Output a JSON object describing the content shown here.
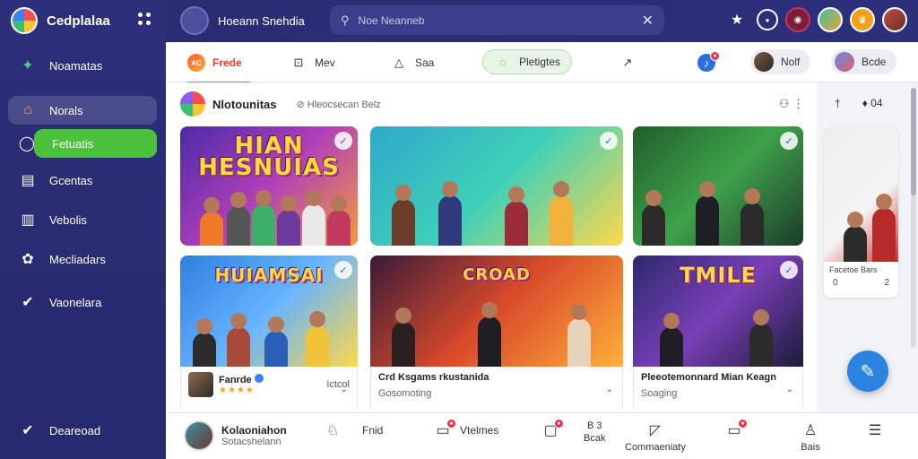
{
  "app": {
    "name": "Cedplalaa"
  },
  "sidebar": {
    "items": [
      {
        "label": "Noamatas",
        "icon": "sparkle-icon"
      },
      {
        "label": "Norals",
        "icon": "home-icon"
      },
      {
        "label": "Fetuatis",
        "icon": "circle-icon"
      },
      {
        "label": "Gcentas",
        "icon": "file-icon"
      },
      {
        "label": "Vebolis",
        "icon": "chart-icon"
      },
      {
        "label": "Mecliadars",
        "icon": "puzzle-icon"
      },
      {
        "label": "Vaonelara",
        "icon": "check-circle-icon"
      }
    ],
    "footer": {
      "label": "Deareoad",
      "icon": "check-icon"
    }
  },
  "header": {
    "profile_label": "Hoeann Snehdia",
    "search": {
      "placeholder": "Noe Neanneb"
    }
  },
  "tabs": [
    {
      "label": "Frede",
      "logo_text": "AC"
    },
    {
      "label": "Mev"
    },
    {
      "label": "Saa"
    },
    {
      "label": "Pletigtes"
    },
    {
      "label": ""
    },
    {
      "label": "Nolf"
    },
    {
      "label": "Bcde"
    }
  ],
  "section": {
    "title": "Nlotounitas",
    "subtitle": "Hleocsecan  Belz"
  },
  "cards": [
    {
      "thumb_text": "HIAN\nHESNUIAS",
      "title": "",
      "subtitle": "",
      "bg": "#6b3fb8"
    },
    {
      "thumb_text": "",
      "title": "",
      "subtitle": "",
      "bg": "#3fb6c8"
    },
    {
      "thumb_text": "",
      "title": "",
      "subtitle": "",
      "bg": "#2e7d3a"
    },
    {
      "thumb_text": "HUIAMSAI",
      "title": "Fanrde",
      "subtitle": "Ictcol",
      "stars": "★★★★",
      "bg": "#3a8fe0"
    },
    {
      "thumb_text": "CROAD",
      "title": "Crd Ksgams rkustanida",
      "subtitle": "Gosomoting",
      "bg": "#8a1e3e"
    },
    {
      "thumb_text": "TMILE",
      "title": "Pleeotemonnard  Mian Keagn",
      "subtitle": "Soaging",
      "bg": "#3a2c6b"
    }
  ],
  "right_panel": {
    "header_a": "†",
    "header_b": "♦ 04",
    "meta": "Facetoe Bars",
    "meta_left": "0",
    "meta_right": "2"
  },
  "bottom": {
    "user_name": "Kolaoniahon",
    "user_sub": "Sotacshelann",
    "items": [
      {
        "label": "Fnid"
      },
      {
        "label": "Vtelmes"
      },
      {
        "label": "Bcak",
        "top": "B 3"
      },
      {
        "label": "Commaeniaty"
      },
      {
        "label": ""
      },
      {
        "label": "Bais"
      },
      {
        "label": ""
      }
    ]
  },
  "colors": {
    "sidebar": "#2c2f7a",
    "accent_green": "#4cc13d",
    "accent_orange": "#ff6b2c",
    "fab": "#2a84e0"
  }
}
